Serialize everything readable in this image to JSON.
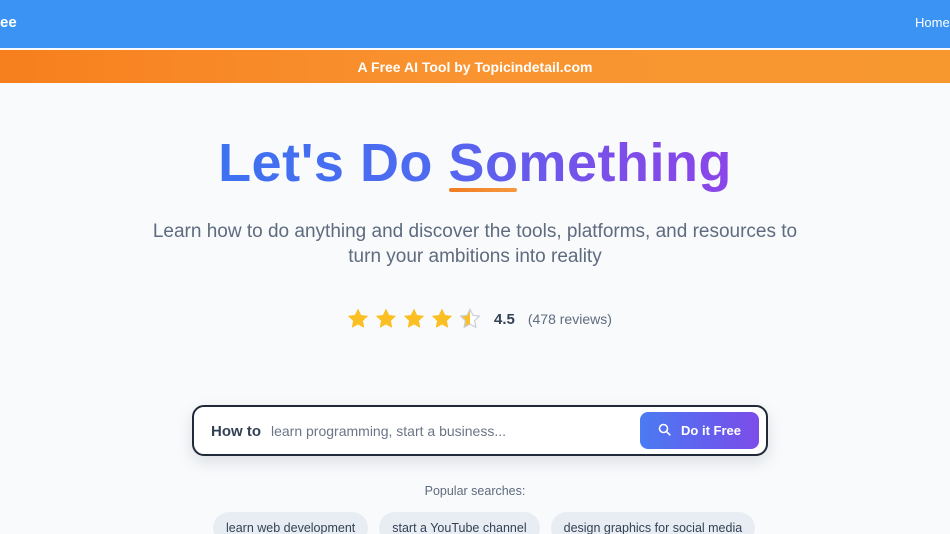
{
  "header": {
    "brand_fragment": "ee",
    "nav_home": "Home"
  },
  "promo_banner": {
    "text": "A Free AI Tool by Topicindetail.com"
  },
  "hero": {
    "title": "Let's Do Something",
    "subtitle_line1": "Learn how to do anything and discover the tools, platforms, and resources to",
    "subtitle_line2": "turn your ambitions into reality"
  },
  "rating": {
    "stars_filled": 4.5,
    "stars_total": 5,
    "value": "4.5",
    "reviews": "(478 reviews)"
  },
  "search": {
    "prefix": "How to",
    "placeholder": "learn programming, start a business...",
    "value": "",
    "button_label": "Do it Free",
    "button_icon": "search-icon"
  },
  "popular": {
    "label": "Popular searches:",
    "chips": [
      "learn web development",
      "start a YouTube channel",
      "design graphics for social media"
    ]
  },
  "colors": {
    "topbar": "#3b94f3",
    "promo_start": "#f77f1d",
    "promo_end": "#f7982f",
    "title_gradient_start": "#3d72f0",
    "title_gradient_end": "#8b45e8",
    "star": "#fbbf24",
    "button_start": "#4b7bf2",
    "button_end": "#7d4ce9"
  }
}
